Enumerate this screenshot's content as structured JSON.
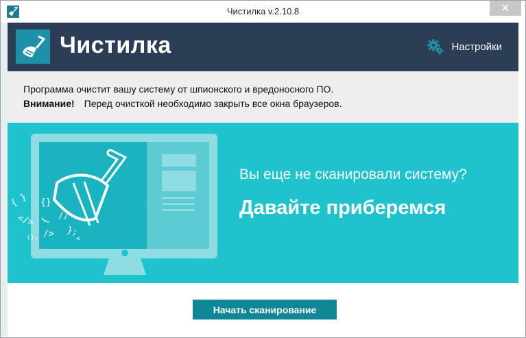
{
  "window": {
    "title": "Чистилка v.2.10.8",
    "close_symbol": "✕"
  },
  "header": {
    "brand": "Чистилка",
    "settings_label": "Настройки",
    "settings_icon": "gear-icon",
    "logo_icon": "broom-icon"
  },
  "info": {
    "line1": "Программа очистит вашу систему от шпионского и вредоносного ПО.",
    "warning_label": "Внимание!",
    "warning_text": "Перед очисткой необходимо закрыть все окна браузеров."
  },
  "banner": {
    "question": "Вы еще не сканировали систему?",
    "call_to_action": "Давайте приберемся"
  },
  "footer": {
    "scan_button": "Начать сканирование"
  },
  "colors": {
    "header_bg": "#2b3e55",
    "logo_bg": "#1e90a8",
    "banner_bg": "#1fc3ce",
    "button_bg": "#0f8797",
    "info_bg": "#eeeeee"
  }
}
